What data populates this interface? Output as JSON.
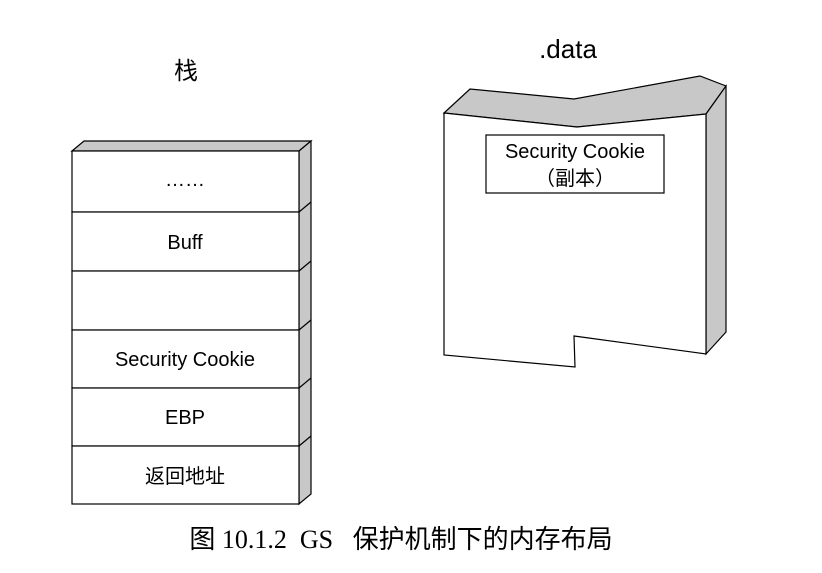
{
  "stack": {
    "title": "栈",
    "cells": [
      {
        "label": "……"
      },
      {
        "label": "Buff"
      },
      {
        "label": ""
      },
      {
        "label": "Security Cookie"
      },
      {
        "label": "EBP"
      },
      {
        "label": "返回地址"
      }
    ]
  },
  "data_section": {
    "title": ".data",
    "cookie_label": "Security Cookie",
    "cookie_sublabel": "（副本）"
  },
  "caption": "图 10.1.2  GS   保护机制下的内存布局",
  "colors": {
    "fill_side": "#c8c8c8",
    "stroke": "#000000",
    "background": "#ffffff"
  }
}
